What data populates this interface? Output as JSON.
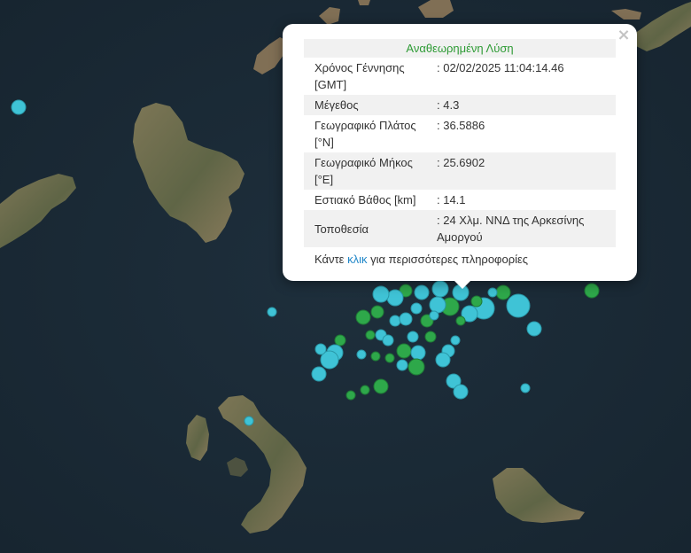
{
  "popup": {
    "title": "Αναθεωρημένη Λύση",
    "close_label": "×",
    "rows": [
      {
        "label": "Χρόνος Γέννησης [GMT]",
        "value": ": 02/02/2025 11:04:14.46"
      },
      {
        "label": "Μέγεθος",
        "value": ": 4.3"
      },
      {
        "label": "Γεωγραφικό Πλάτος [°N]",
        "value": ": 36.5886"
      },
      {
        "label": "Γεωγραφικό Μήκος [°E]",
        "value": ": 25.6902"
      },
      {
        "label": "Εστιακό Βάθος [km]",
        "value": ": 14.1"
      },
      {
        "label": "Τοποθεσία",
        "value": ": 24 Χλμ. ΝΝΔ της Αρκεσίνης Αμοργού"
      }
    ],
    "more_prefix": "Κάντε ",
    "more_link": "κλικ",
    "more_suffix": " για περισσότερες πληροφορίες"
  },
  "colors": {
    "sea": "#1b2a36",
    "land": "#6b6a4e",
    "marker_cyan": "#3fc3d6",
    "marker_green": "#2ea84a",
    "title_green": "#2e9b35",
    "link_blue": "#1f86c8"
  }
}
